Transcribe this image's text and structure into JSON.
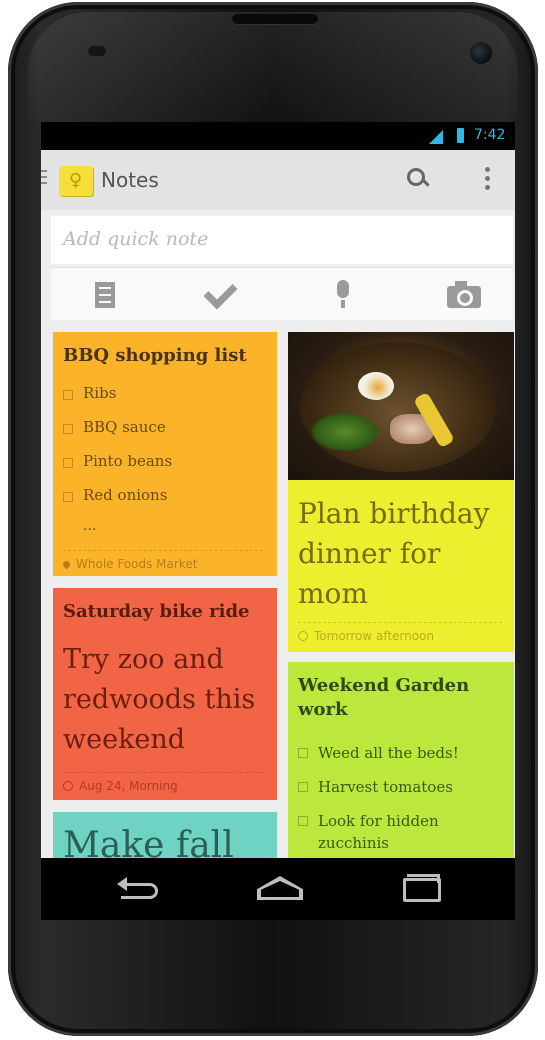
{
  "status_bar": {
    "time": "7:42"
  },
  "action_bar": {
    "title": "Notes"
  },
  "quick_note": {
    "placeholder": "Add quick note"
  },
  "notes": {
    "bbq": {
      "title": "BBQ shopping list",
      "items": [
        "Ribs",
        "BBQ sauce",
        "Pinto beans",
        "Red onions"
      ],
      "more": "...",
      "location": "Whole Foods Market",
      "color": "#fbb42a"
    },
    "bike": {
      "title": "Saturday bike ride",
      "body": "Try zoo and redwoods this weekend",
      "reminder": "Aug 24, Morning",
      "color": "#f26446"
    },
    "fall": {
      "body": "Make fall",
      "color": "#6fd3c4"
    },
    "birthday": {
      "body": "Plan birthday dinner for mom",
      "reminder": "Tomorrow afternoon",
      "color": "#ecee2e"
    },
    "garden": {
      "title": "Weekend Garden work",
      "items": [
        "Weed all the beds!",
        "Harvest tomatoes",
        "Look for hidden zucchinis"
      ],
      "color": "#bce83e"
    }
  },
  "icons": {
    "toolbar": [
      "text-note-icon",
      "checklist-icon",
      "microphone-icon",
      "camera-icon"
    ],
    "nav": [
      "back-icon",
      "home-icon",
      "recent-apps-icon"
    ]
  }
}
